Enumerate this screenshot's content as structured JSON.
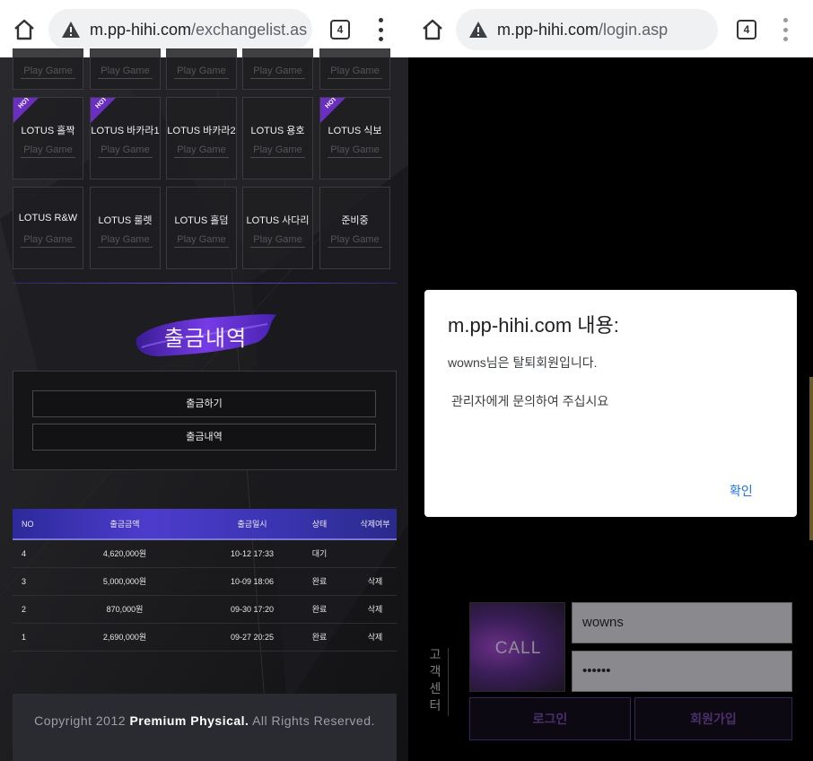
{
  "left_browser": {
    "url_host": "m.pp-hihi.com",
    "url_path": "/exchangelist.as",
    "tab_count": "4"
  },
  "right_browser": {
    "url_host": "m.pp-hihi.com",
    "url_path": "/login.asp",
    "tab_count": "4"
  },
  "games_partial_row": [
    {
      "play": "Play Game"
    },
    {
      "play": "Play Game"
    },
    {
      "play": "Play Game"
    },
    {
      "play": "Play Game"
    },
    {
      "play": "Play Game"
    }
  ],
  "games_row1": [
    {
      "name": "LOTUS 홀짝",
      "play": "Play Game",
      "hot": true
    },
    {
      "name": "LOTUS 바카라1",
      "play": "Play Game",
      "hot": true
    },
    {
      "name": "LOTUS 바카라2",
      "play": "Play Game",
      "hot": false
    },
    {
      "name": "LOTUS 용호",
      "play": "Play Game",
      "hot": false
    },
    {
      "name": "LOTUS 식보",
      "play": "Play Game",
      "hot": true
    }
  ],
  "games_row2": [
    {
      "name": "LOTUS R&W",
      "play": "Play Game"
    },
    {
      "name": "LOTUS 룰렛",
      "play": "Play Game"
    },
    {
      "name": "LOTUS 홀덤",
      "play": "Play Game"
    },
    {
      "name": "LOTUS 사다리",
      "play": "Play Game"
    },
    {
      "name": "준비중",
      "play": "Play Game"
    }
  ],
  "hot_badge": "HOT",
  "withdraw": {
    "title": "출금내역",
    "btn_withdraw": "출금하기",
    "btn_history": "출금내역"
  },
  "table": {
    "headers": [
      "NO",
      "출금금액",
      "출금일시",
      "상태",
      "삭제여부"
    ],
    "rows": [
      [
        "4",
        "4,620,000원",
        "10-12 17:33",
        "대기",
        ""
      ],
      [
        "3",
        "5,000,000원",
        "10-09 18:06",
        "완료",
        "삭제"
      ],
      [
        "2",
        "870,000원",
        "09-30 17:20",
        "완료",
        "삭제"
      ],
      [
        "1",
        "2,690,000원",
        "09-27 20:25",
        "완료",
        "삭제"
      ]
    ]
  },
  "footer": {
    "prefix": "Copyright 2012 ",
    "brand": "Premium Physical.",
    "suffix": " All Rights Reserved."
  },
  "dialog": {
    "title": "m.pp-hihi.com 내용:",
    "message1": "wowns님은 탈퇴회원입니다.",
    "message2": "관리자에게 문의하여 주십시요",
    "ok": "확인"
  },
  "login": {
    "cs_label": "고객센터",
    "call": "CALL",
    "username": "wowns",
    "password": "••••••",
    "login_btn": "로그인",
    "join_btn": "회원가입"
  },
  "colors": {
    "accent_purple": "#4d3ccc",
    "hot_badge": "#6a2fc0",
    "dialog_ok": "#1a73e8"
  }
}
